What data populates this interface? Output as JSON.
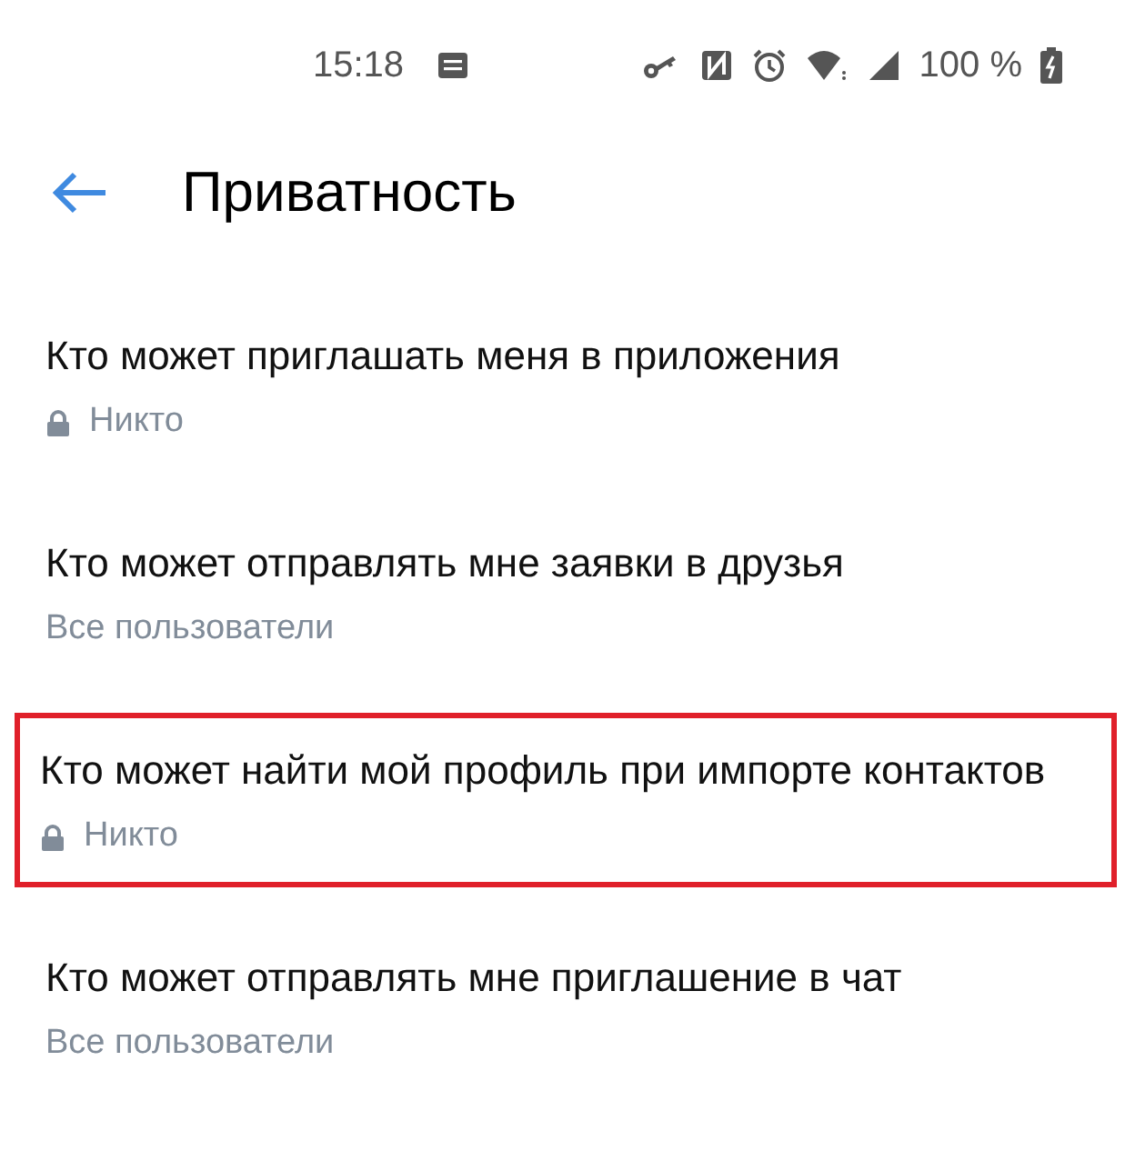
{
  "status_bar": {
    "time": "15:18",
    "battery": "100 %"
  },
  "header": {
    "title": "Приватность"
  },
  "settings": [
    {
      "title": "Кто может приглашать меня в приложения",
      "value": "Никто",
      "locked": true,
      "highlighted": false
    },
    {
      "title": "Кто может отправлять мне заявки в друзья",
      "value": "Все пользователи",
      "locked": false,
      "highlighted": false
    },
    {
      "title": "Кто может найти мой профиль при импорте контактов",
      "value": "Никто",
      "locked": true,
      "highlighted": true
    },
    {
      "title": "Кто может отправлять мне приглашение в чат",
      "value": "Все пользователи",
      "locked": false,
      "highlighted": false
    }
  ]
}
